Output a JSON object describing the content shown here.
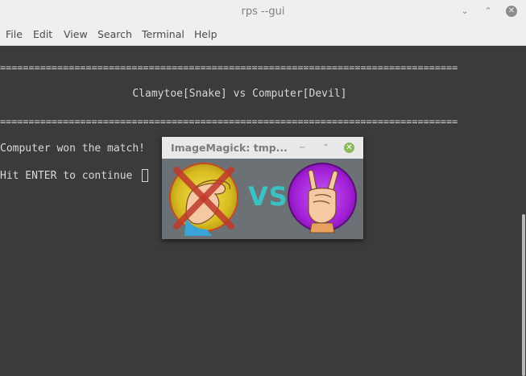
{
  "window": {
    "title": "rps --gui",
    "buttons": {
      "minimize": "⌄",
      "maximize": "⌃",
      "close": "✕"
    }
  },
  "menu": {
    "items": [
      "File",
      "Edit",
      "View",
      "Search",
      "Terminal",
      "Help"
    ]
  },
  "terminal": {
    "lines": [
      "================================================================================",
      "                     Clamytoe[Snake] vs Computer[Devil]",
      "================================================================================",
      "Computer won the match!",
      "Hit ENTER to continue "
    ]
  },
  "popup": {
    "title": "ImageMagick: tmp...",
    "buttons": {
      "minimize": "−",
      "maximize": "⌃",
      "close": "✕"
    },
    "vs_text": "VS",
    "left_icon": "snake-hand-icon",
    "right_icon": "devil-horns-hand-icon",
    "colors": {
      "left_circle": "#e0c020",
      "right_circle": "#b020e0",
      "cross": "#c0392b",
      "vs": "#3ac2c2"
    }
  }
}
